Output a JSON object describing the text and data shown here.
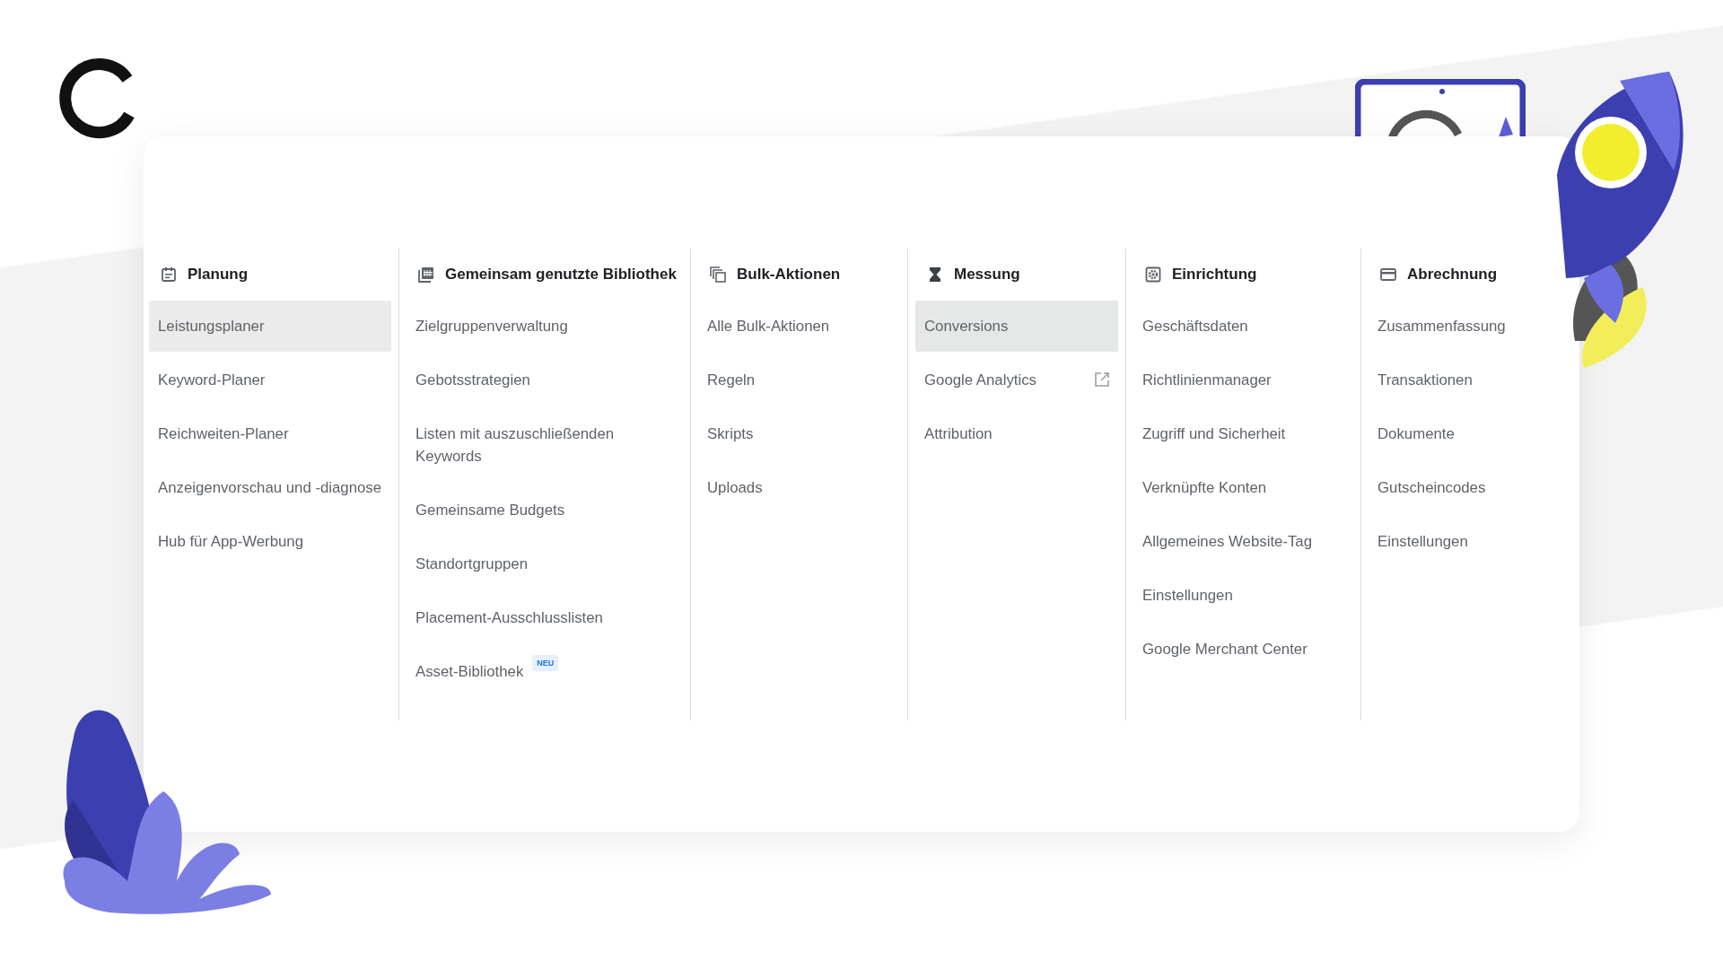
{
  "columns": [
    {
      "title": "Planung",
      "items": [
        {
          "label": "Leistungsplaner",
          "selected": true,
          "external": false
        },
        {
          "label": "Keyword-Planer",
          "selected": false,
          "external": false
        },
        {
          "label": "Reichweiten-Planer",
          "selected": false,
          "external": false
        },
        {
          "label": "Anzeigenvorschau und -diagnose",
          "selected": false,
          "external": false
        },
        {
          "label": "Hub für App-Werbung",
          "selected": false,
          "external": false
        }
      ]
    },
    {
      "title": "Gemeinsam genutzte Bibliothek",
      "items": [
        {
          "label": "Zielgruppenverwaltung",
          "selected": false,
          "external": false
        },
        {
          "label": "Gebotsstrategien",
          "selected": false,
          "external": false
        },
        {
          "label": "Listen mit auszuschließenden Keywords",
          "selected": false,
          "external": false
        },
        {
          "label": "Gemeinsame Budgets",
          "selected": false,
          "external": false
        },
        {
          "label": "Standortgruppen",
          "selected": false,
          "external": false
        },
        {
          "label": "Placement-Ausschlusslisten",
          "selected": false,
          "external": false
        },
        {
          "label": "Asset-Bibliothek",
          "selected": false,
          "external": false,
          "badge": "NEU"
        }
      ]
    },
    {
      "title": "Bulk-Aktionen",
      "items": [
        {
          "label": "Alle Bulk-Aktionen",
          "selected": false,
          "external": false
        },
        {
          "label": "Regeln",
          "selected": false,
          "external": false
        },
        {
          "label": "Skripts",
          "selected": false,
          "external": false
        },
        {
          "label": "Uploads",
          "selected": false,
          "external": false
        }
      ]
    },
    {
      "title": "Messung",
      "items": [
        {
          "label": "Conversions",
          "selected": true,
          "external": false
        },
        {
          "label": "Google Analytics",
          "selected": false,
          "external": true
        },
        {
          "label": "Attribution",
          "selected": false,
          "external": false
        }
      ]
    },
    {
      "title": "Einrichtung",
      "items": [
        {
          "label": "Geschäftsdaten",
          "selected": false,
          "external": false
        },
        {
          "label": "Richtlinienmanager",
          "selected": false,
          "external": false
        },
        {
          "label": "Zugriff und Sicherheit",
          "selected": false,
          "external": false
        },
        {
          "label": "Verknüpfte Konten",
          "selected": false,
          "external": false
        },
        {
          "label": "Allgemeines Website-Tag",
          "selected": false,
          "external": false
        },
        {
          "label": "Einstellungen",
          "selected": false,
          "external": false
        },
        {
          "label": "Google Merchant Center",
          "selected": false,
          "external": false
        }
      ]
    },
    {
      "title": "Abrechnung",
      "items": [
        {
          "label": "Zusammenfassung",
          "selected": false,
          "external": false
        },
        {
          "label": "Transaktionen",
          "selected": false,
          "external": false
        },
        {
          "label": "Dokumente",
          "selected": false,
          "external": false
        },
        {
          "label": "Gutscheincodes",
          "selected": false,
          "external": false
        },
        {
          "label": "Einstellungen",
          "selected": false,
          "external": false
        }
      ]
    }
  ]
}
